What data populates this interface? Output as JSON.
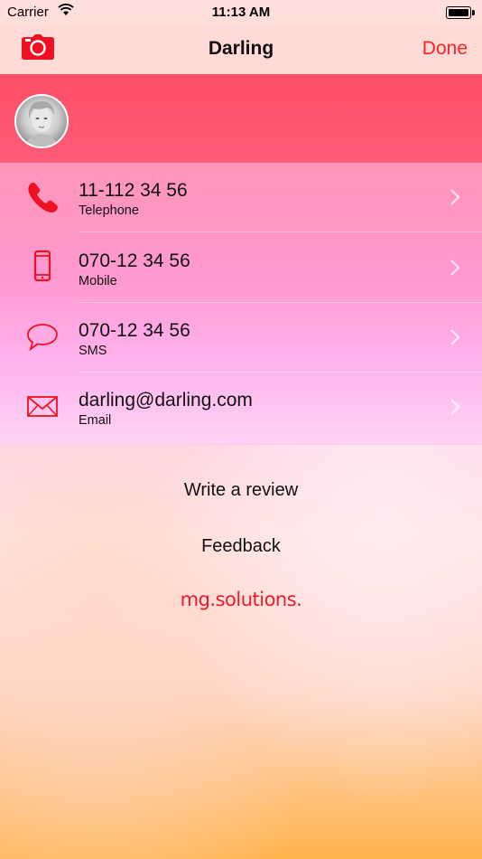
{
  "status_bar": {
    "carrier": "Carrier",
    "time": "11:13 AM"
  },
  "nav": {
    "title": "Darling",
    "done_label": "Done",
    "camera_icon": "camera-icon"
  },
  "contacts": [
    {
      "value": "11-112 34 56",
      "label": "Telephone",
      "icon": "phone-icon"
    },
    {
      "value": "070-12 34 56",
      "label": "Mobile",
      "icon": "mobile-icon"
    },
    {
      "value": "070-12 34 56",
      "label": "SMS",
      "icon": "speech-bubble-icon"
    },
    {
      "value": "darling@darling.com",
      "label": "Email",
      "icon": "envelope-icon"
    }
  ],
  "links": {
    "review": "Write a review",
    "feedback": "Feedback",
    "brand": "mg.solutions."
  },
  "colors": {
    "accent": "#ff2222",
    "profile_bg": "#ff4d66"
  }
}
